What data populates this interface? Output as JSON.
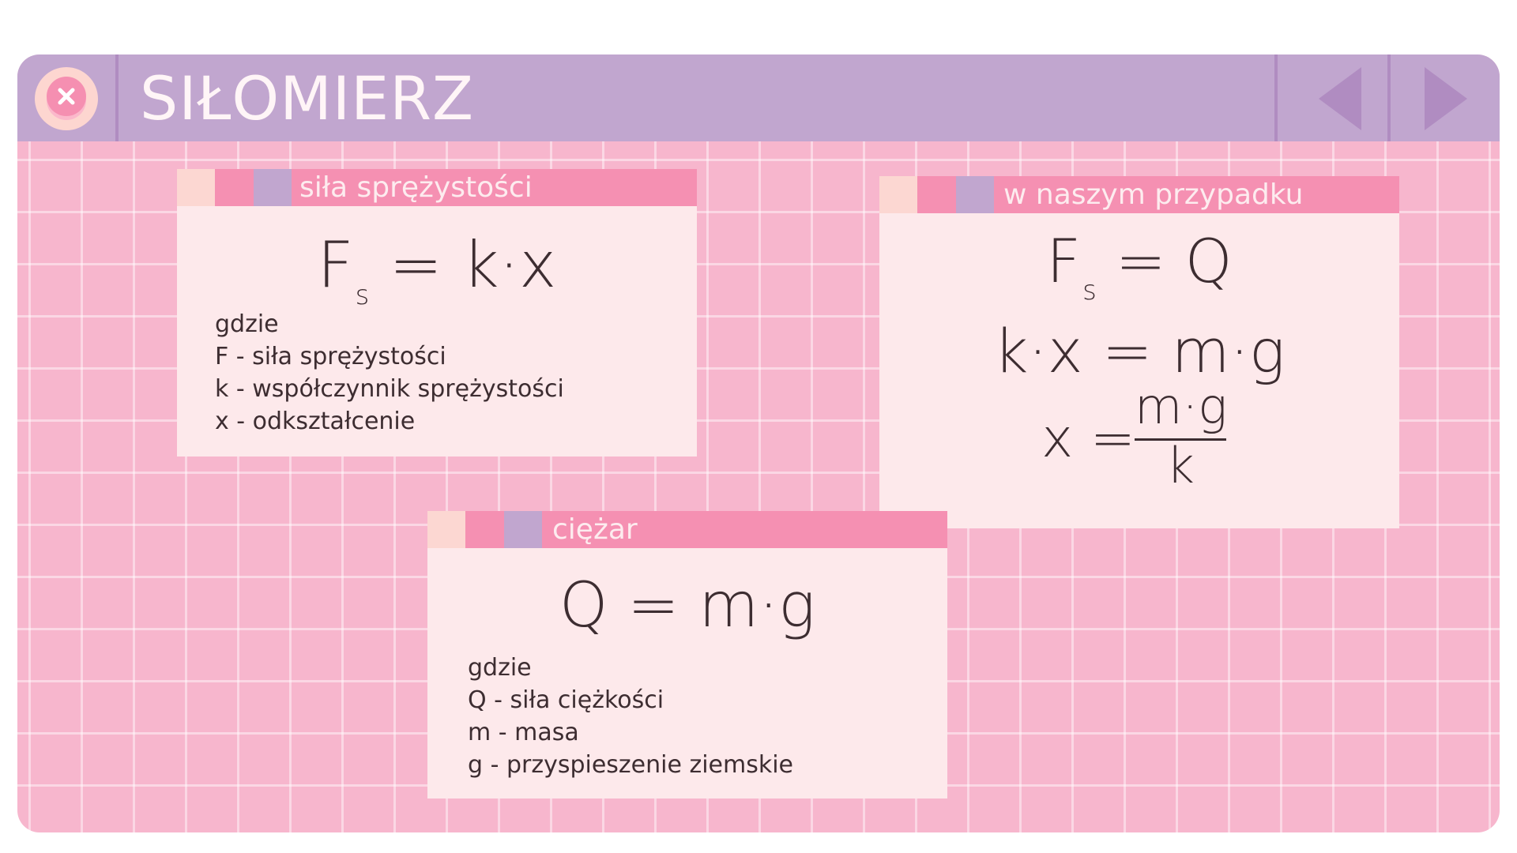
{
  "window": {
    "title": "SIŁOMIERZ"
  },
  "titlebar": {
    "close_icon": "close-x-icon",
    "prev_icon": "triangle-left-icon",
    "next_icon": "triangle-right-icon"
  },
  "colors": {
    "background": "#f7b6cd",
    "titlebar": "#c1a6cf",
    "card": "#fde9eb",
    "card_header": "#f590b2",
    "accent_light": "#fcd7d2",
    "accent_purple": "#c1a6cf",
    "text": "#3d2d31"
  },
  "cards": {
    "spring": {
      "label": "siła sprężystości",
      "formula_main": "F",
      "formula_sub": "s",
      "formula_rest": " = k·x",
      "legend": [
        "gdzie",
        "F - siła sprężystości",
        "k - współczynnik sprężystości",
        "x - odkształcenie"
      ]
    },
    "case": {
      "label": "w naszym przypadku",
      "line1_main": "F",
      "line1_sub": "s",
      "line1_rest": " = Q",
      "line2": "k·x = m·g",
      "line3_lhs": "x =",
      "line3_num": "m·g",
      "line3_den": "k"
    },
    "weight": {
      "label": "ciężar",
      "formula": "Q = m·g",
      "legend": [
        "gdzie",
        "Q - siła ciężkości",
        "m - masa",
        "g - przyspieszenie ziemskie"
      ]
    }
  }
}
